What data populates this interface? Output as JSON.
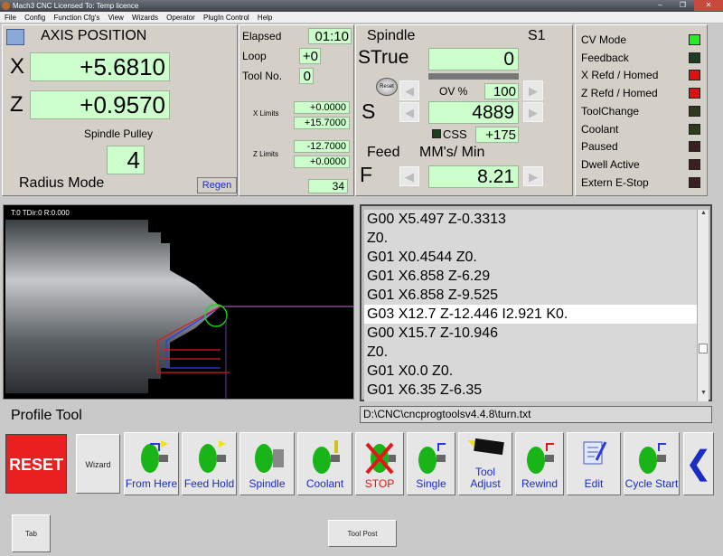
{
  "window": {
    "title": "Mach3 CNC  Licensed To: Temp licence",
    "min": "–",
    "max": "❐",
    "close": "✕"
  },
  "menu": [
    "File",
    "Config",
    "Function Cfg's",
    "View",
    "Wizards",
    "Operator",
    "PlugIn Control",
    "Help"
  ],
  "axis": {
    "title": "AXIS POSITION",
    "x_label": "X",
    "x_value": "+5.6810",
    "z_label": "Z",
    "z_value": "+0.9570",
    "pulley_label": "Spindle Pulley",
    "pulley_value": "4",
    "mode": "Radius Mode",
    "regen": "Regen"
  },
  "stats": {
    "elapsed_label": "Elapsed",
    "elapsed_value": "01:10",
    "loop_label": "Loop",
    "loop_value": "+0",
    "tool_label": "Tool No.",
    "tool_value": "0",
    "xlim_label": "X Limits",
    "xlim_min": "+0.0000",
    "xlim_max": "+15.7000",
    "zlim_label": "Z Limits",
    "zlim_min": "-12.7000",
    "zlim_max": "+0.0000",
    "line_no": "34"
  },
  "spindle": {
    "title": "Spindle",
    "s1": "S1",
    "s_true_label": "STrue",
    "s_true_value": "0",
    "reset": "Reset",
    "ov_label": "OV %",
    "ov_value": "100",
    "s_label": "S",
    "s_value": "4889",
    "css_label": "CSS",
    "css_value": "+175",
    "feed_label": "Feed",
    "feed_units": "MM's/ Min",
    "f_label": "F",
    "f_value": "8.21"
  },
  "leds": [
    {
      "label": "CV Mode",
      "color": "#22ee22"
    },
    {
      "label": "Feedback",
      "color": "#1e3d1e"
    },
    {
      "label": "X Refd / Homed",
      "color": "#dd1111"
    },
    {
      "label": "Z Refd / Homed",
      "color": "#dd1111"
    },
    {
      "label": "ToolChange",
      "color": "#2e3a1a"
    },
    {
      "label": "Coolant",
      "color": "#2e3a1a"
    },
    {
      "label": "Paused",
      "color": "#3b2020"
    },
    {
      "label": "Dwell Active",
      "color": "#3b2020"
    },
    {
      "label": "Extern E-Stop",
      "color": "#3b2020"
    }
  ],
  "toolpath": {
    "info": "T:0 TDir:0 R:0.000"
  },
  "gcode": {
    "lines": [
      "G00 X5.497 Z-0.3313",
      "Z0.",
      "G01 X0.4544 Z0.",
      "G01 X6.858 Z-6.29",
      "G01 X6.858 Z-9.525",
      "G03 X12.7 Z-12.446 I2.921 K0.",
      "G00 X15.7 Z-10.946",
      "Z0.",
      "G01 X0.0 Z0.",
      "G01 X6.35 Z-6.35"
    ],
    "highlight": 5,
    "file": "D:\\CNC\\cncprogtoolsv4.4.8\\turn.txt"
  },
  "profile_label": "Profile Tool",
  "buttons": {
    "reset": "RESET",
    "wizard": "Wizard",
    "from_here": "From Here",
    "feed_hold": "Feed Hold",
    "spindle": "Spindle",
    "coolant": "Coolant",
    "stop": "STOP",
    "single": "Single",
    "tool_adjust_1": "Tool",
    "tool_adjust_2": "Adjust",
    "rewind": "Rewind",
    "edit": "Edit",
    "cycle_start": "Cycle Start",
    "tab": "Tab",
    "tool_post": "Tool Post"
  }
}
